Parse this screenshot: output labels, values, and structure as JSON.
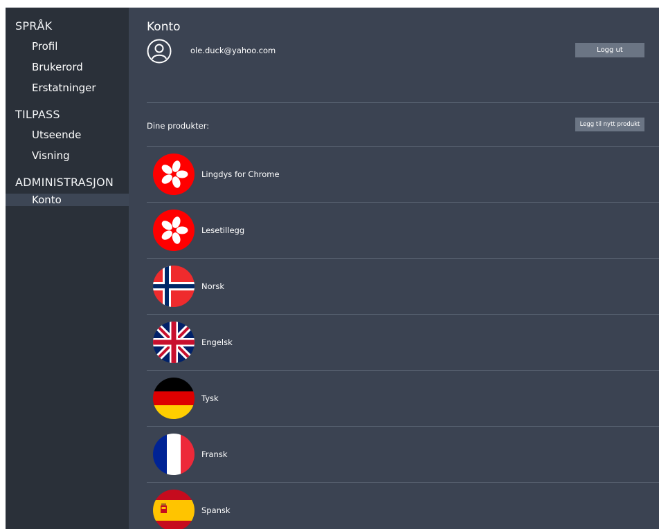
{
  "sidebar": {
    "sections": [
      {
        "title": "SPRÅK",
        "items": [
          "Profil",
          "Brukerord",
          "Erstatninger"
        ]
      },
      {
        "title": "TILPASS",
        "items": [
          "Utseende",
          "Visning"
        ]
      },
      {
        "title": "ADMINISTRASJON",
        "items": [
          "Konto"
        ]
      }
    ],
    "active_item": "Konto"
  },
  "account": {
    "title": "Konto",
    "email": "ole.duck@yahoo.com",
    "logout_label": "Logg ut"
  },
  "products": {
    "label": "Dine produkter:",
    "add_label": "Legg til nytt produkt",
    "items": [
      {
        "name": "Lingdys for Chrome",
        "icon": "lingdys-flower-icon"
      },
      {
        "name": "Lesetillegg",
        "icon": "lingdys-flower-icon"
      },
      {
        "name": "Norsk",
        "icon": "norway-flag-icon"
      },
      {
        "name": "Engelsk",
        "icon": "uk-flag-icon"
      },
      {
        "name": "Tysk",
        "icon": "germany-flag-icon"
      },
      {
        "name": "Fransk",
        "icon": "france-flag-icon"
      },
      {
        "name": "Spansk",
        "icon": "spain-flag-icon"
      }
    ]
  },
  "colors": {
    "sidebar_bg": "#2a3039",
    "main_bg": "#3b4352",
    "button_bg": "#6b7584",
    "brand_red": "#ff0000"
  }
}
